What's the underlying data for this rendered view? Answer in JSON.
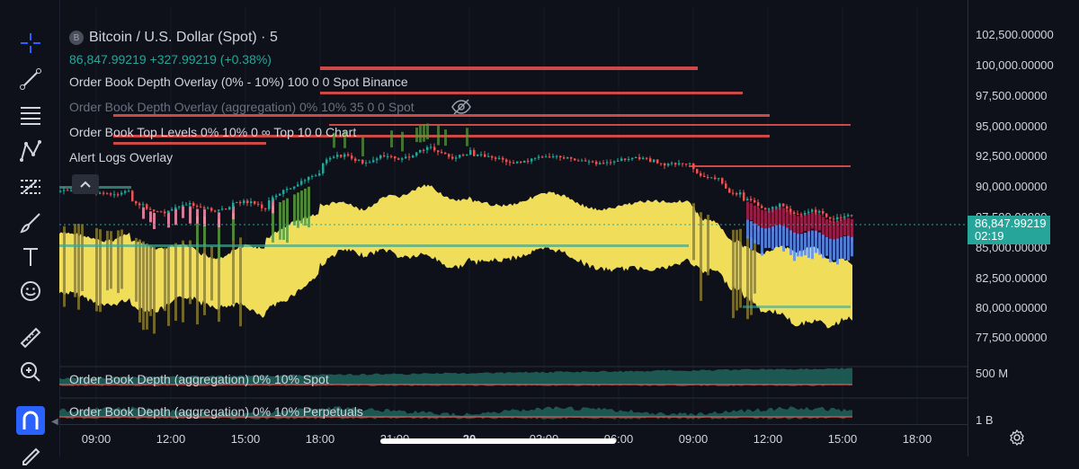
{
  "symbol": {
    "coin_letter": "B",
    "title": "Bitcoin / U.S. Dollar (Spot) · 5",
    "price": "86,847.99219",
    "change": "+327.99219 (+0.38%)"
  },
  "indicators": [
    {
      "label": "Order Book Depth Overlay (0% - 10%) 100 0 0 Spot Binance",
      "hidden": false
    },
    {
      "label": "Order Book Depth Overlay (aggregation) 0% 10% 35 0 0 Spot",
      "hidden": true
    },
    {
      "label": "Order Book Top Levels 0% 10% 0 ∞ Top 10 0 Chart",
      "hidden": false
    },
    {
      "label": "Alert Logs Overlay",
      "hidden": false
    }
  ],
  "panes": {
    "spot": "Order Book Depth (aggregation) 0% 10% Spot",
    "perp": "Order Book Depth (aggregation) 0% 10% Perpetuals"
  },
  "price_axis": {
    "ticks": [
      "102,500.00000",
      "100,000.00000",
      "97,500.00000",
      "95,000.00000",
      "92,500.00000",
      "90,000.00000",
      "87,500.00000",
      "85,000.00000",
      "82,500.00000",
      "80,000.00000",
      "77,500.00000"
    ],
    "pane_spot_tick": "500 M",
    "pane_perp_tick": "1 B",
    "last_price": "86,847.99219",
    "countdown": "02:19"
  },
  "time_axis": {
    "ticks": [
      "09:00",
      "12:00",
      "15:00",
      "18:00",
      "21:00",
      "20",
      "03:00",
      "06:00",
      "09:00",
      "12:00",
      "15:00",
      "18:00"
    ]
  },
  "tools": [
    "crosshair-icon",
    "trendline-icon",
    "fib-icon",
    "pattern-icon",
    "projection-icon",
    "brush-icon",
    "text-icon",
    "emoji-icon",
    "ruler-icon",
    "zoom-icon",
    "magnet-icon",
    "pencil-icon"
  ],
  "colors": {
    "background": "#0e111a",
    "up": "#26a69a",
    "down": "#ef5350",
    "depth_yellow": "#fde95d",
    "depth_olive": "#8b7d32",
    "depth_green": "#5a9a3e",
    "depth_pink": "#f48fb1",
    "depth_blue": "#5b8def",
    "depth_crimson": "#a0204a"
  }
}
